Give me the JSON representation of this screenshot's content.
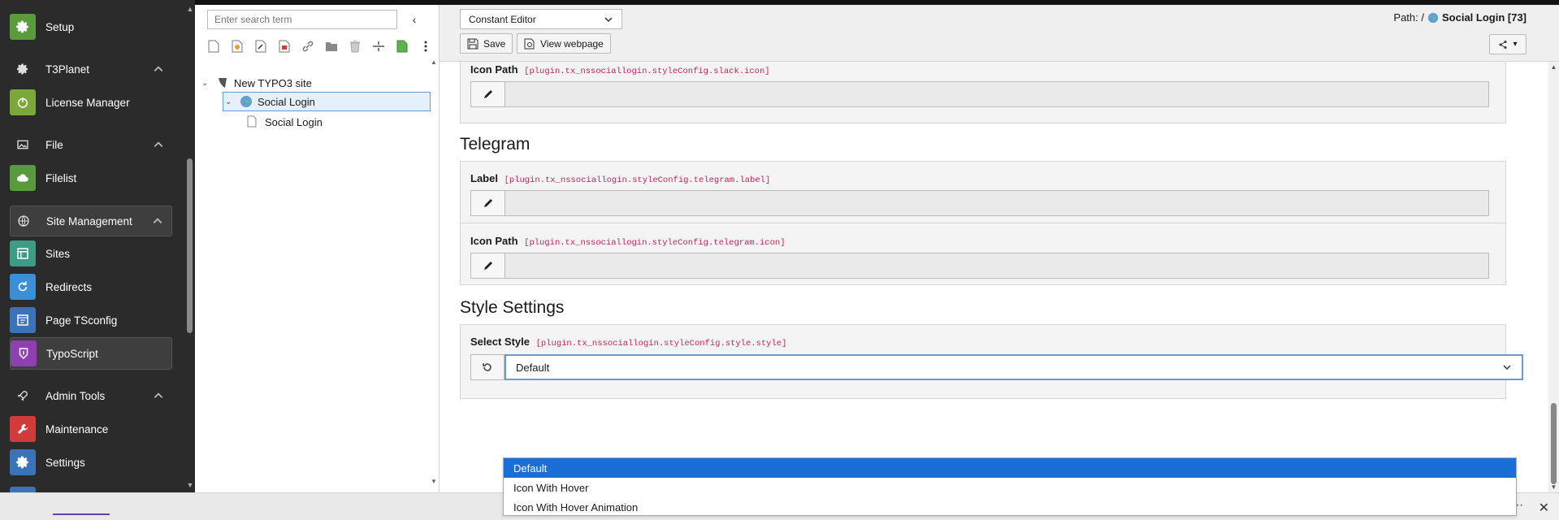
{
  "sidebar": {
    "items": [
      {
        "label": "Setup",
        "icon": "gear-icon",
        "color": "#5c9a3e"
      },
      {
        "label": "T3Planet",
        "icon": "gear-icon",
        "type": "group"
      },
      {
        "label": "License Manager",
        "icon": "power-icon",
        "color": "#7aa83a"
      },
      {
        "label": "File",
        "icon": "image-icon",
        "type": "group"
      },
      {
        "label": "Filelist",
        "icon": "cloud-icon",
        "color": "#5a9a3e"
      },
      {
        "label": "Site Management",
        "icon": "globe-icon",
        "type": "group"
      },
      {
        "label": "Sites",
        "icon": "sites-icon",
        "color": "#3d9b86"
      },
      {
        "label": "Redirects",
        "icon": "redirect-icon",
        "color": "#3a8fd6"
      },
      {
        "label": "Page TSconfig",
        "icon": "tsconfig-icon",
        "color": "#3a73b8"
      },
      {
        "label": "TypoScript",
        "icon": "typoscript-icon",
        "color": "#8e3fb0"
      },
      {
        "label": "Admin Tools",
        "icon": "rocket-icon",
        "type": "group"
      },
      {
        "label": "Maintenance",
        "icon": "wrench-icon",
        "color": "#d13b3b"
      },
      {
        "label": "Settings",
        "icon": "gear-icon",
        "color": "#3a73b8"
      }
    ]
  },
  "tree": {
    "search_placeholder": "Enter search term",
    "nodes": [
      {
        "label": "New TYPO3 site",
        "level": 0
      },
      {
        "label": "Social Login",
        "level": 1
      },
      {
        "label": "Social Login",
        "level": 2
      }
    ]
  },
  "header": {
    "editor_select": "Constant Editor",
    "save_label": "Save",
    "view_label": "View webpage",
    "path_prefix": "Path: /",
    "path_page": "Social Login [73]"
  },
  "content": {
    "slack_icon_label": "Icon Path",
    "slack_icon_key": "[plugin.tx_nssociallogin.styleConfig.slack.icon]",
    "telegram_title": "Telegram",
    "telegram_label_label": "Label",
    "telegram_label_key": "[plugin.tx_nssociallogin.styleConfig.telegram.label]",
    "telegram_icon_label": "Icon Path",
    "telegram_icon_key": "[plugin.tx_nssociallogin.styleConfig.telegram.icon]",
    "style_title": "Style Settings",
    "style_select_label": "Select Style",
    "style_select_key": "[plugin.tx_nssociallogin.styleConfig.style.style]",
    "style_select_value": "Default"
  },
  "dropdown": {
    "options": [
      "Default",
      "Icon With Hover",
      "Icon With Hover Animation"
    ],
    "selected_index": 0
  },
  "colors": {
    "sidebar_bg": "#2b2b2b",
    "key_color": "#c0245e",
    "selected_option": "#1a6fd6",
    "focus_border": "#6a9bd6"
  }
}
